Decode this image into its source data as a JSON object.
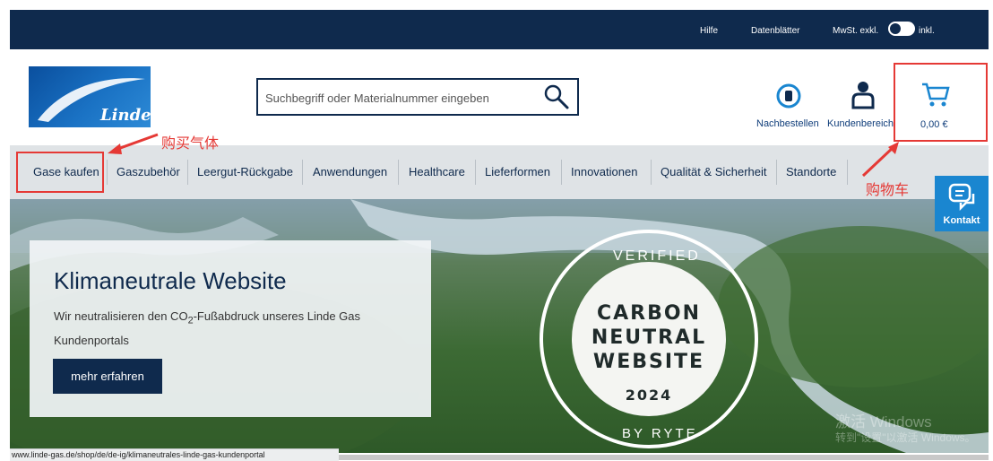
{
  "topbar": {
    "help": "Hilfe",
    "datasheets": "Datenblätter",
    "vat_excl": "MwSt. exkl.",
    "vat_incl": "inkl."
  },
  "logo": {
    "text": "Linde"
  },
  "search": {
    "placeholder": "Suchbegriff oder Materialnummer eingeben"
  },
  "header_actions": {
    "reorder": "Nachbestellen",
    "account": "Kundenbereich",
    "cart_total": "0,00 €"
  },
  "annotations": {
    "buy_gas": "购买气体",
    "cart": "购物车"
  },
  "nav": {
    "items": [
      "Gase kaufen",
      "Gaszubehör",
      "Leergut-Rückgabe",
      "Anwendungen",
      "Healthcare",
      "Lieferformen",
      "Innovationen",
      "Qualität & Sicherheit",
      "Standorte"
    ]
  },
  "kontakt": {
    "label": "Kontakt"
  },
  "hero": {
    "title": "Klimaneutrale Website",
    "text_before": "Wir neutralisieren den CO",
    "text_sub": "2",
    "text_after": "-Fußabdruck unseres Linde Gas Kundenportals",
    "button": "mehr erfahren",
    "badge": {
      "top": "VERIFIED",
      "line1": "CARBON",
      "line2": "NEUTRAL",
      "line3": "WEBSITE",
      "year": "2024",
      "bottom": "BY RYTE"
    }
  },
  "watermark": {
    "line1": "激活 Windows",
    "line2": "转到\"设置\"以激活 Windows。"
  },
  "status_url": "www.linde-gas.de/shop/de/de-ig/klimaneutrales-linde-gas-kundenportal",
  "colors": {
    "navy": "#0f2a4d",
    "accent_blue": "#1a86d0",
    "annotation_red": "#e53935",
    "nav_bg": "#dfe3e6"
  }
}
